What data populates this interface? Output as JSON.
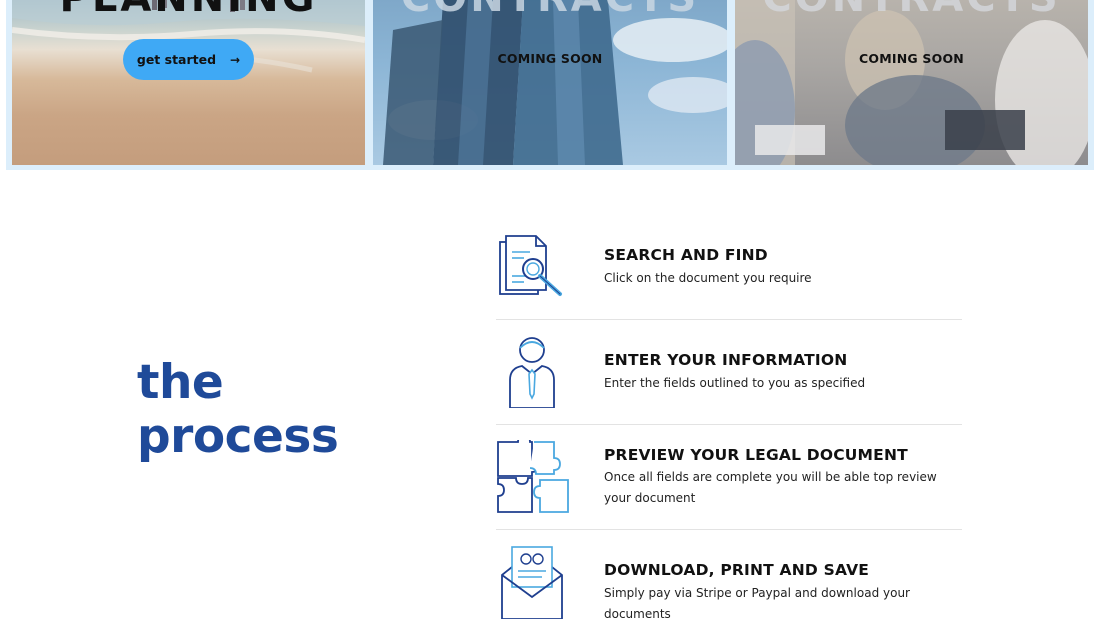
{
  "cards": [
    {
      "title": "PLANNING",
      "button_label": "get started",
      "button_arrow": "→"
    },
    {
      "title": "CONTRACTS",
      "status": "COMING SOON"
    },
    {
      "title": "CONTRACTS",
      "status": "COMING SOON"
    }
  ],
  "process": {
    "heading_line1": "the",
    "heading_line2": "process",
    "steps": [
      {
        "title": "SEARCH AND FIND",
        "desc": "Click on the document you require",
        "icon": "document-search-icon"
      },
      {
        "title": "ENTER YOUR INFORMATION",
        "desc": "Enter the fields outlined to you as specified",
        "icon": "person-tie-icon"
      },
      {
        "title": "PREVIEW YOUR LEGAL DOCUMENT",
        "desc": "Once all fields are complete you will be able top review your document",
        "icon": "puzzle-icon"
      },
      {
        "title": "DOWNLOAD, PRINT AND SAVE",
        "desc": "Simply pay via Stripe or Paypal and download your documents",
        "icon": "envelope-report-icon"
      }
    ]
  },
  "colors": {
    "accent_blue": "#3fa9f5",
    "heading_navy": "#1f4a99",
    "icon_navy": "#1f3f8f",
    "icon_light": "#4aa8e0",
    "band": "#dceefb"
  }
}
